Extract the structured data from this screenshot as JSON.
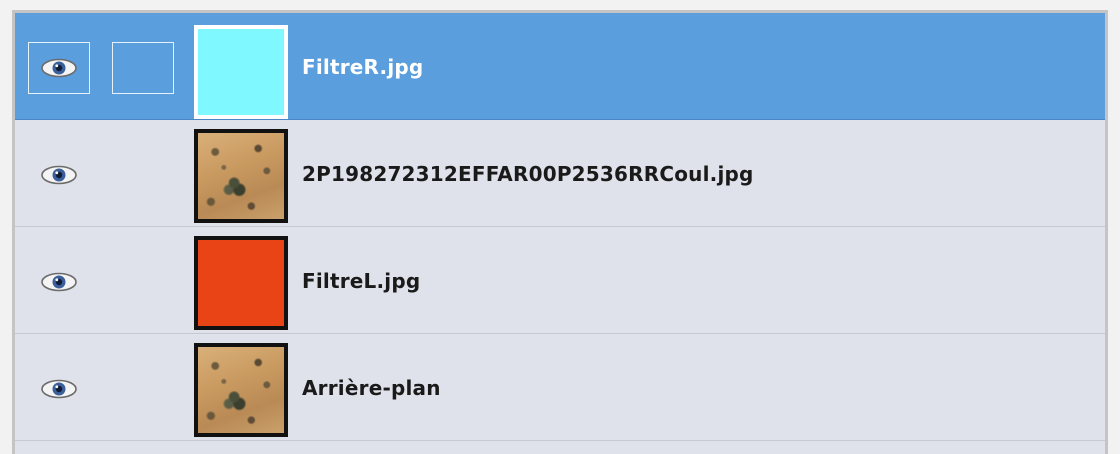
{
  "layers_panel": {
    "layers": [
      {
        "name": "FiltreR.jpg",
        "selected": true,
        "visible": true,
        "thumbnail": "cyan-fill",
        "thumbnail_color": "#7ff8ff"
      },
      {
        "name": "2P198272312EFFAR00P2536RRCoul.jpg",
        "selected": false,
        "visible": true,
        "thumbnail": "mars-terrain-photo"
      },
      {
        "name": "FiltreL.jpg",
        "selected": false,
        "visible": true,
        "thumbnail": "orange-fill",
        "thumbnail_color": "#e84416"
      },
      {
        "name": "Arrière-plan",
        "selected": false,
        "visible": true,
        "thumbnail": "mars-terrain-photo"
      }
    ]
  },
  "colors": {
    "selection": "#5b9ede",
    "panel_background": "#dfe2ea"
  },
  "icons": {
    "visibility": "eye-icon"
  }
}
